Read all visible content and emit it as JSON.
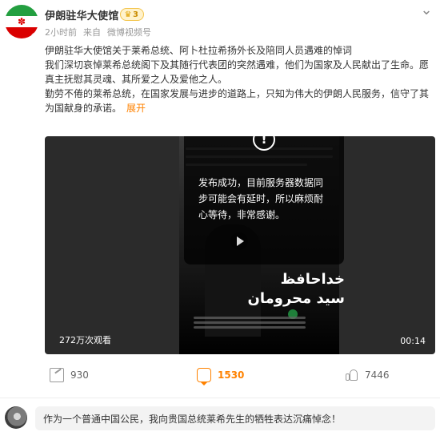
{
  "account": {
    "name": "伊朗驻华大使馆",
    "badge_level": "3",
    "time": "2小时前",
    "source_prefix": "来自",
    "source": "微博视频号"
  },
  "post": {
    "lines": [
      "伊朗驻华大使馆关于莱希总统、阿卜杜拉希扬外长及陪同人员遇难的悼词",
      "我们深切哀悼莱希总统阁下及其随行代表团的突然遇难，他们为国家及人民献出了生命。愿真主抚慰其灵魂、其所爱之人及爱他之人。",
      "勤劳不倦的莱希总统，在国家发展与进步的道路上，只知为伟大的伊朗人民服务，信守了其为国献身的承诺。"
    ],
    "expand_label": "展开"
  },
  "video": {
    "overlay_message": "发布成功，目前服务器数据同步可能会有延时，所以麻烦耐心等待，非常感谢。",
    "arabic_line1": "خداحافظ",
    "arabic_line2": "سید محرومان",
    "views": "272万次观看",
    "duration": "00:14",
    "overlay_icon": "warning-icon"
  },
  "actions": {
    "share": {
      "icon": "share-icon",
      "count": "930"
    },
    "comment": {
      "icon": "comment-icon",
      "count": "1530"
    },
    "like": {
      "icon": "like-icon",
      "count": "7446"
    }
  },
  "comment": {
    "text": "作为一个普通中国公民，我向贵国总统莱希先生的牺牲表达沉痛悼念！"
  },
  "colors": {
    "accent": "#ff8200",
    "verified": "#2ea0ff"
  }
}
